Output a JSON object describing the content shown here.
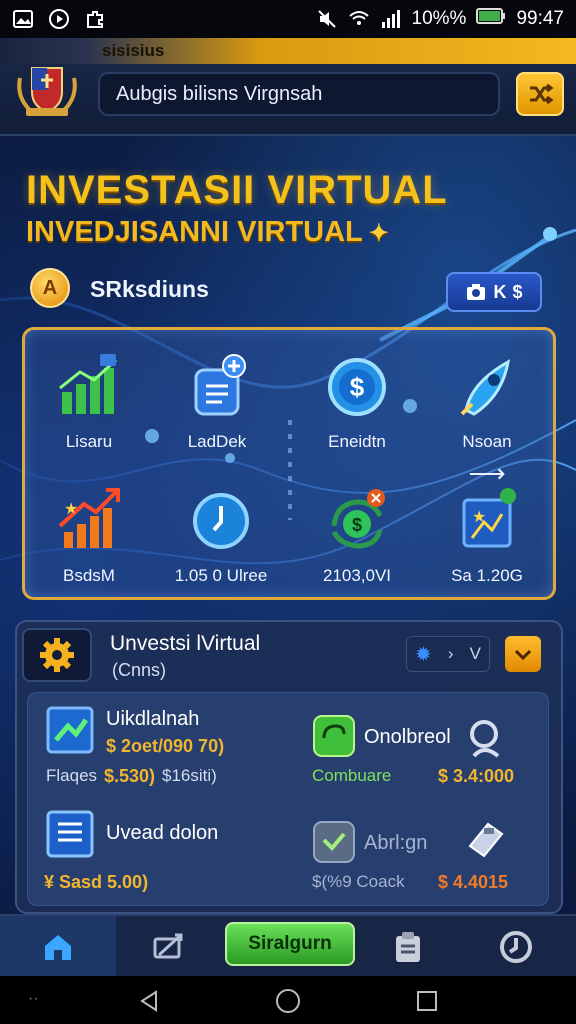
{
  "status_bar": {
    "icons_left": [
      "gallery-icon",
      "play-icon",
      "puzzle-icon"
    ],
    "icons_right": [
      "mute-icon",
      "wifi-icon",
      "signal-icon",
      "battery-icon"
    ],
    "battery_text": "10%%",
    "time": "99:47"
  },
  "header": {
    "strip_text": "sisisius",
    "search_value": "Aubgis bilisns Virgnsah"
  },
  "titles": {
    "title1": "INVESTASII VIRTUAL",
    "title2": "INVEDJISANNI VIRTUAL"
  },
  "balance": {
    "coin_letter": "A",
    "label": "SRksdiuns",
    "button_text": "K"
  },
  "features": [
    {
      "label": "Lisaru",
      "icon": "bar-chart-icon"
    },
    {
      "label": "LadDek",
      "icon": "document-add-icon"
    },
    {
      "label": "Eneidtn",
      "icon": "dollar-coin-icon"
    },
    {
      "label": "Nsoan",
      "icon": "rocket-icon"
    },
    {
      "label": "BsdsM",
      "icon": "growth-arrow-icon"
    },
    {
      "label": "1.05 0 Ulree",
      "icon": "clock-icon"
    },
    {
      "label": "2103,0VI",
      "icon": "money-cycle-icon"
    },
    {
      "label": "Sa 1.20G",
      "icon": "portfolio-icon"
    }
  ],
  "invest_panel": {
    "title": "Unvestsi lVirtual",
    "subtitle": "(Cnns)",
    "toggle_right": "V",
    "items": [
      {
        "name": "Uikdlalnah",
        "value": "$ 2oet/090 70)",
        "sub": "Flaqes",
        "sub_value": "$.530)",
        "sub_extra": "$16siti)",
        "icon": "chart-card-icon"
      },
      {
        "name": "Onolbreol",
        "sub": "Combuare",
        "value": "$ 3.4:000",
        "icon": "chat-green-icon",
        "extra_icon": "search-person-icon"
      },
      {
        "name": "Uvead dolon",
        "value": "¥ Sasd 5.00)",
        "icon": "list-doc-icon"
      },
      {
        "name": "Abrl:gn",
        "sub": "$(%9 Coack",
        "value": "$ 4.4015",
        "icon": "shield-green-icon",
        "extra_icon": "wallet-icon"
      }
    ]
  },
  "bottom_nav": {
    "cta_label": "Siralgurn",
    "items": [
      "home-icon",
      "transfer-icon",
      "cta",
      "clipboard-icon",
      "clock-nav-icon"
    ]
  },
  "colors": {
    "accent_gold": "#f5c21c",
    "accent_green": "#4cc13c",
    "panel_border": "#e0a93c",
    "background": "#0c1a3a"
  }
}
